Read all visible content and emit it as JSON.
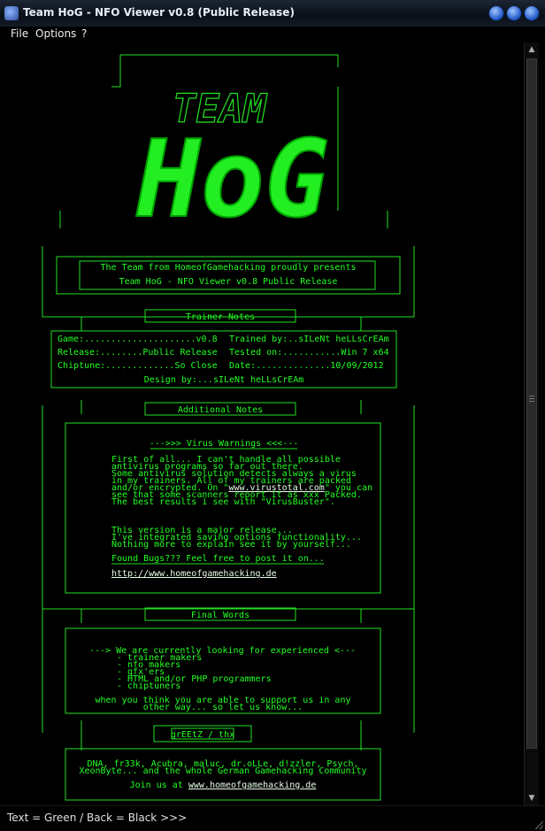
{
  "window": {
    "title": "Team HoG - NFO Viewer v0.8 (Public Release)"
  },
  "menu": {
    "items": [
      "File",
      "Options",
      "?"
    ]
  },
  "nfo": {
    "logo": {
      "small": "TEAM",
      "big": "HoG"
    },
    "header": {
      "line1": "The Team from HomeofGamehacking proudly presents",
      "line2": "Team HoG - NFO Viewer v0.8 Public Release"
    },
    "trainer_notes": {
      "title": "Trainer Notes",
      "row1_left": "Game:.....................v0.8",
      "row1_right": "Trained by:..sILeNt heLLsCrEAm",
      "row2_left": "Release:........Public Release",
      "row2_right": "Tested on:...........Win 7 x64",
      "row3_left": "Chiptune:.............So Close",
      "row3_right": "Date:..............10/09/2012",
      "design": "Design by:...sILeNt heLLsCrEAm"
    },
    "additional_notes": {
      "title": "Additional Notes",
      "virus_header": "--->>> Virus Warnings <<<---",
      "p1": [
        "First of all... I can't handle all possible",
        "antivirus programs so far out there.",
        "Some antivirus solution detects always a virus",
        "in my trainers. All of my trainers are packed"
      ],
      "p1_line5_pre": "and/or encrypted. On \"",
      "p1_line5_link": "www.virustotal.com",
      "p1_line5_post": "\" you can",
      "p1_line6": "see that some scanners report it as xxx Packed.",
      "p1_line7": "The best results i see with \"VirusBuster\".",
      "p2": [
        "This version is a major release...",
        "I've integrated saving options functionality...",
        "Nothing more to explain see it by yourself..."
      ],
      "bugs": "Found Bugs??? Feel free to post it on...",
      "url": "http://www.homeofgamehacking.de"
    },
    "final_words": {
      "title": "Final Words",
      "lines": [
        "---> We are currently looking for experienced <---",
        "- trainer makers",
        "- nfo makers",
        "- gfx'ers",
        "- HTML and/or PHP programmers",
        "- chiptuners"
      ],
      "support1": "when you think you are able to support us in any",
      "support2": "other way... so let us know..."
    },
    "greetz": {
      "title": "grEEtZ / thx",
      "line1": "DNA, fr33k, Acubra, maluc, dr.oLLe, d!zzler, Psych,",
      "line2": "XeonByte... and the whole German Gamehacking Community",
      "join_pre": "Join us at ",
      "join_link": "www.homeofgamehacking.de"
    }
  },
  "status": {
    "text": "Text = Green / Back = Black   >>>"
  },
  "colors": {
    "nfo_text": "#22ff22",
    "background": "#000000"
  }
}
